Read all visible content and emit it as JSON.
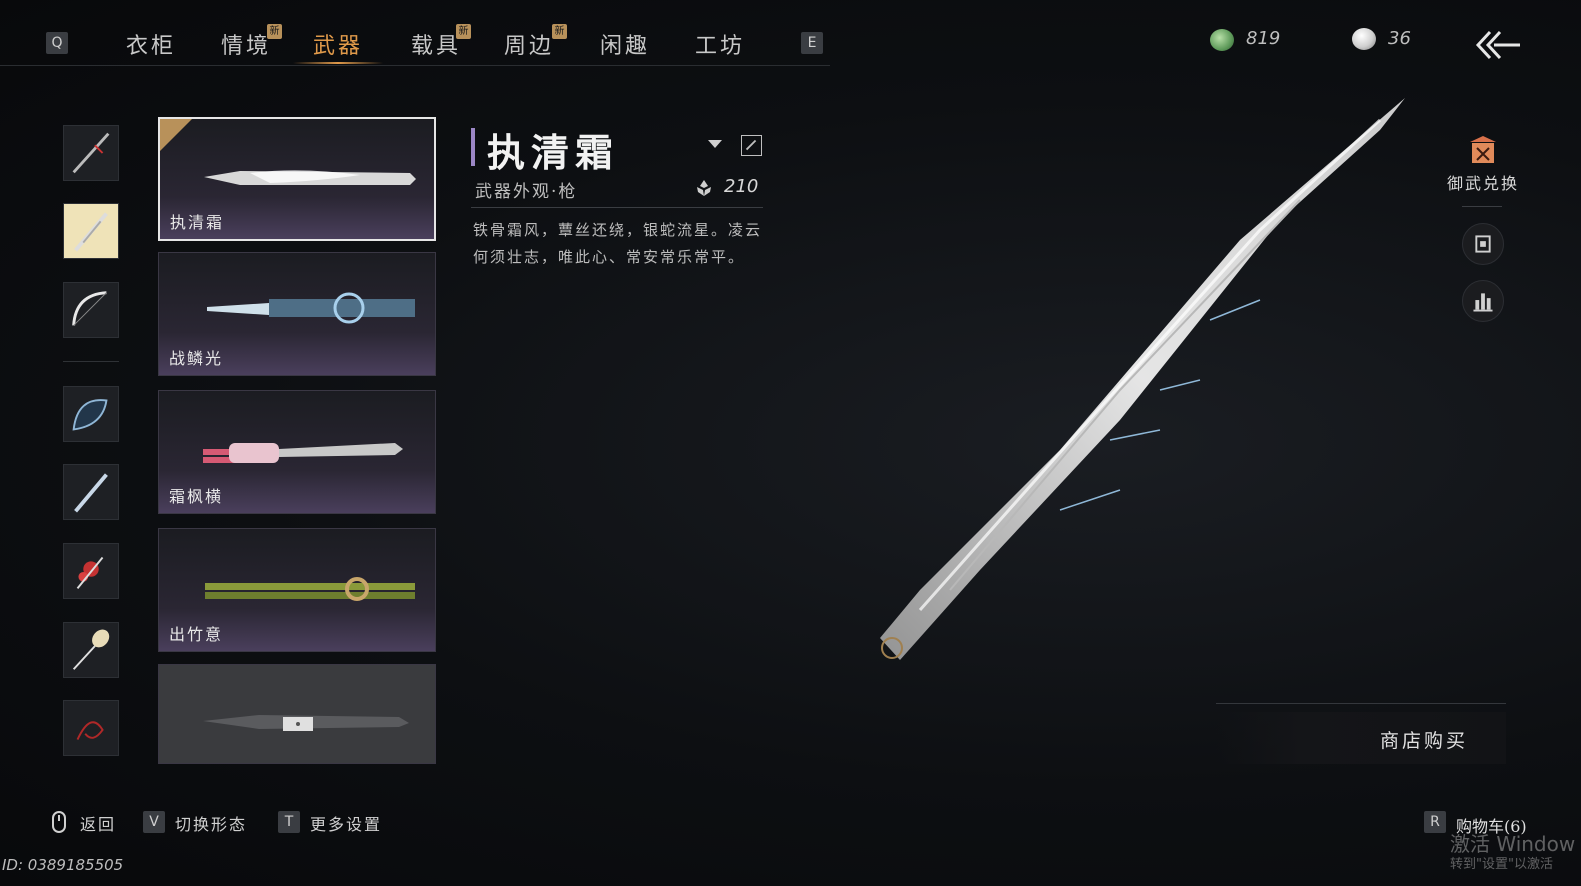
{
  "nav": {
    "left_key": "Q",
    "right_key": "E",
    "tabs": [
      {
        "label": "衣柜",
        "new": false
      },
      {
        "label": "情境",
        "new": true
      },
      {
        "label": "武器",
        "new": false,
        "active": true
      },
      {
        "label": "载具",
        "new": true
      },
      {
        "label": "周边",
        "new": true
      },
      {
        "label": "闲趣",
        "new": false
      },
      {
        "label": "工坊",
        "new": false
      }
    ],
    "new_badge": "新"
  },
  "currency": {
    "jade": "819",
    "pearl": "36"
  },
  "categories": [
    "spear-category-icon",
    "scroll-category-icon",
    "bow-category-icon",
    "fan-category-icon",
    "blade-category-icon",
    "flower-category-icon",
    "racket-category-icon",
    "ribbon-category-icon"
  ],
  "weapons": [
    {
      "name": "执清霜",
      "selected": true
    },
    {
      "name": "战鳞光",
      "selected": false
    },
    {
      "name": "霜枫横",
      "selected": false
    },
    {
      "name": "出竹意",
      "selected": false
    },
    {
      "name": "",
      "locked": true
    }
  ],
  "detail": {
    "title": "执清霜",
    "subtitle": "武器外观·枪",
    "score": "210",
    "description": "铁骨霜风，蕈丝还绕，银蛇流星。凌云何须壮志，唯此心、常安常乐常平。"
  },
  "side": {
    "exchange_label": "御武兑换"
  },
  "shop": {
    "buy_label": "商店购买"
  },
  "footer": {
    "back_label": "返回",
    "switch_key": "V",
    "switch_label": "切换形态",
    "settings_key": "T",
    "settings_label": "更多设置",
    "cart_key": "R",
    "cart_label": "购物车(6)",
    "id_text": "ID: 0389185505"
  },
  "watermark": {
    "line1": "激活 Window",
    "line2": "转到\"设置\"以激活"
  },
  "colors": {
    "accent": "#e09a4a",
    "gold_badge": "#b8915a",
    "title_bar": "#9c87c6"
  }
}
